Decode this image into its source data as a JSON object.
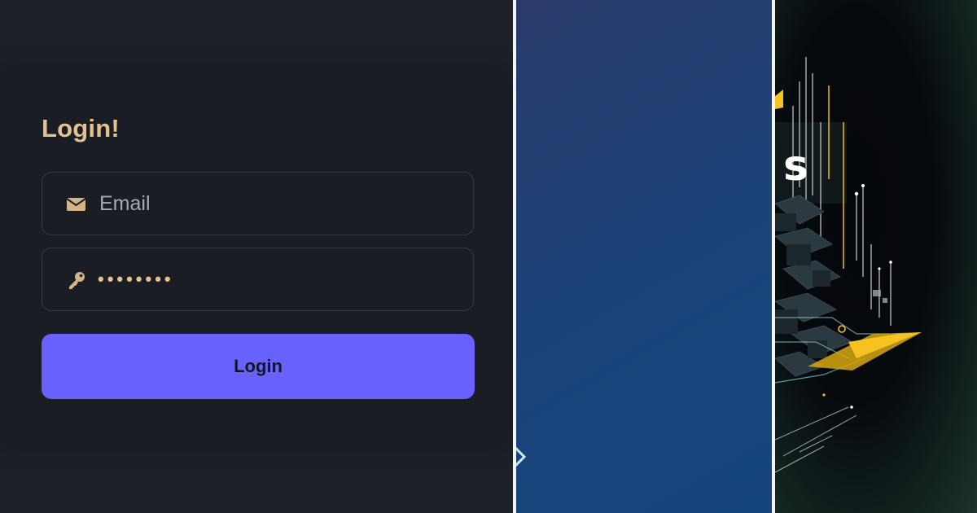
{
  "login": {
    "title": "Login!",
    "email_placeholder": "Email",
    "email_icon": "envelope-icon",
    "password_icon": "key-icon",
    "password_mask": "••••••••",
    "button_label": "Login"
  },
  "art": {
    "visible_letter": "s"
  },
  "colors": {
    "background": "#1d2027",
    "card": "#1a1d24",
    "accent_gold": "#e3c28f",
    "button": "#6762fb",
    "input_border": "#363a44",
    "blue_panel": "#1d4277"
  }
}
